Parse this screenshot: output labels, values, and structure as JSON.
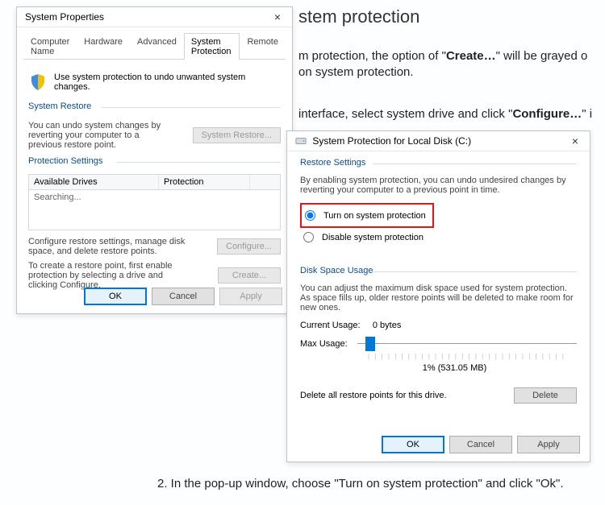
{
  "bg": {
    "heading": "stem protection",
    "p1_a": "m protection, the option of \"",
    "p1_b": "Create…",
    "p1_c": "\" will be grayed o",
    "p1_d": "on system protection.",
    "p2_a": "interface, select system drive and click \"",
    "p2_b": "Configure…",
    "p2_c": "\" i",
    "step2": "2. In the pop-up window, choose \"Turn on system protection\" and click \"Ok\"."
  },
  "win1": {
    "title": "System Properties",
    "close": "×",
    "tabs": [
      "Computer Name",
      "Hardware",
      "Advanced",
      "System Protection",
      "Remote"
    ],
    "intro": "Use system protection to undo unwanted system changes.",
    "group_restore": "System Restore",
    "restore_text": "You can undo system changes by reverting your computer to a previous restore point.",
    "btn_restore": "System Restore...",
    "group_settings": "Protection Settings",
    "col_drives": "Available Drives",
    "col_protection": "Protection",
    "row_searching": "Searching...",
    "cfg_text": "Configure restore settings, manage disk space, and delete restore points.",
    "btn_configure": "Configure...",
    "create_text": "To create a restore point, first enable protection by selecting a drive and clicking Configure.",
    "btn_create": "Create...",
    "btn_ok": "OK",
    "btn_cancel": "Cancel",
    "btn_apply": "Apply"
  },
  "win2": {
    "title": "System Protection for Local Disk (C:)",
    "close": "×",
    "group_restore": "Restore Settings",
    "restore_desc": "By enabling system protection, you can undo undesired changes by reverting your computer to a previous point in time.",
    "radio_on": "Turn on system protection",
    "radio_off": "Disable system protection",
    "group_disk": "Disk Space Usage",
    "disk_desc": "You can adjust the maximum disk space used for system protection. As space fills up, older restore points will be deleted to make room for new ones.",
    "current_label": "Current Usage:",
    "current_value": "0 bytes",
    "max_label": "Max Usage:",
    "pct": "1% (531.05 MB)",
    "delete_desc": "Delete all restore points for this drive.",
    "btn_delete": "Delete",
    "btn_ok": "OK",
    "btn_cancel": "Cancel",
    "btn_apply": "Apply"
  }
}
